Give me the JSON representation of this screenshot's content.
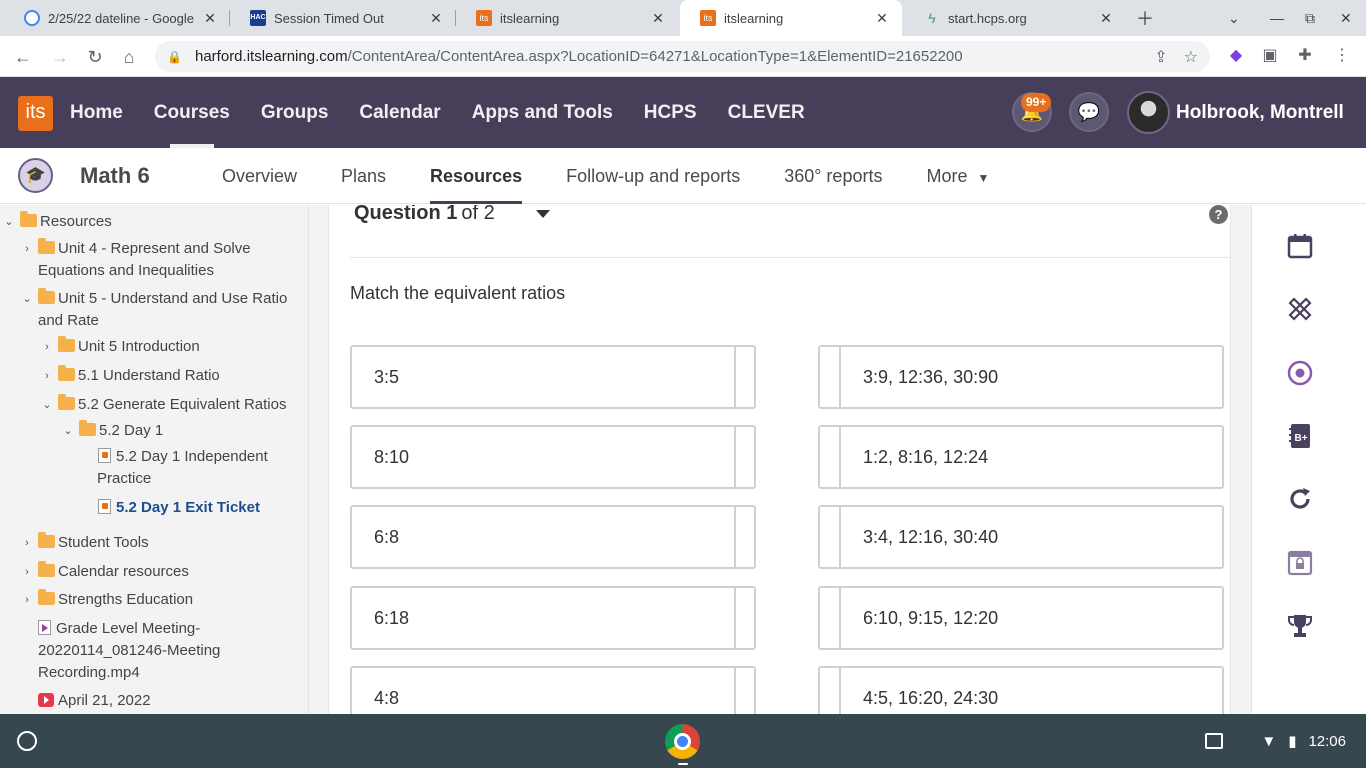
{
  "browser": {
    "tabs": [
      {
        "title": "2/25/22 dateline - Google",
        "favicon": "google-icon"
      },
      {
        "title": "Session Timed Out",
        "favicon": "hac-icon"
      },
      {
        "title": "itslearning",
        "favicon": "its-icon"
      },
      {
        "title": "itslearning",
        "favicon": "its-icon",
        "active": true
      },
      {
        "title": "start.hcps.org",
        "favicon": "hcps-icon"
      }
    ],
    "url_host": "harford.itslearning.com",
    "url_path": "/ContentArea/ContentArea.aspx?LocationID=64271&LocationType=1&ElementID=21652200"
  },
  "its": {
    "logo": "its",
    "nav": [
      "Home",
      "Courses",
      "Groups",
      "Calendar",
      "Apps and Tools",
      "HCPS",
      "CLEVER"
    ],
    "notifications_badge": "99+",
    "user_name": "Holbrook, Montrell"
  },
  "course": {
    "title": "Math 6",
    "nav": [
      "Overview",
      "Plans",
      "Resources",
      "Follow-up and reports",
      "360° reports",
      "More"
    ],
    "active_nav": "Resources"
  },
  "sidebar": {
    "root": "Resources",
    "items": [
      {
        "label": "Unit 4 - Represent and Solve",
        "label2": "Equations and Inequalities"
      },
      {
        "label": "Unit 5 - Understand and Use Ratio",
        "label2": "and Rate"
      },
      {
        "label": "Unit 5 Introduction"
      },
      {
        "label": "5.1 Understand Ratio"
      },
      {
        "label": "5.2 Generate Equivalent Ratios"
      },
      {
        "label": "5.2 Day 1"
      },
      {
        "label": "5.2 Day 1 Independent",
        "label2": "Practice"
      },
      {
        "label": "5.2 Day 1 Exit Ticket"
      },
      {
        "label": "Student Tools"
      },
      {
        "label": "Calendar resources"
      },
      {
        "label": "Strengths Education"
      },
      {
        "label": "Grade Level Meeting-",
        "label2": "20220114_081246-Meeting",
        "label3": "Recording.mp4"
      },
      {
        "label": "April 21, 2022"
      }
    ]
  },
  "question": {
    "number": "Question 1",
    "of": "of 2",
    "help": "?",
    "prompt": "Match the equivalent ratios",
    "left": [
      "3:5",
      "8:10",
      "6:8",
      "6:18",
      "4:8"
    ],
    "right": [
      "3:9, 12:36, 30:90",
      "1:2, 8:16, 12:24",
      "3:4, 12:16, 30:40",
      "6:10, 9:15, 12:20",
      "4:5, 16:20, 24:30"
    ]
  },
  "taskbar": {
    "time": "12:06"
  },
  "colors": {
    "header_bg": "#473f59",
    "accent_orange": "#e86f1c",
    "selected_link": "#1f4e8c"
  }
}
